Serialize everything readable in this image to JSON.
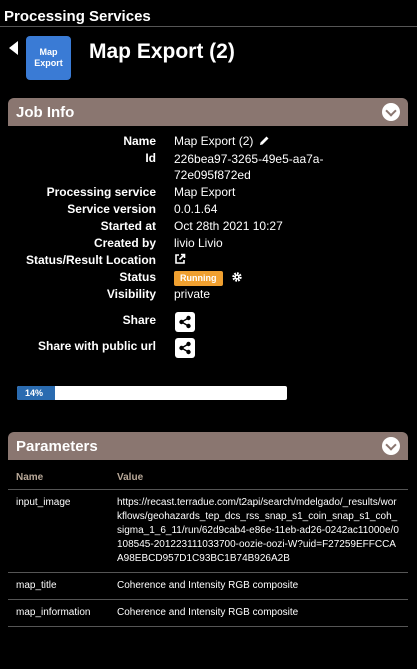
{
  "topbar": {
    "title": "Processing Services"
  },
  "header": {
    "icon_label": "Map Export",
    "title": "Map Export (2)"
  },
  "job_info": {
    "heading": "Job Info",
    "name_label": "Name",
    "name_value": "Map Export (2)",
    "id_label": "Id",
    "id_value": "226bea97-3265-49e5-aa7a-72e095f872ed",
    "service_label": "Processing service",
    "service_value": "Map Export",
    "version_label": "Service version",
    "version_value": "0.0.1.64",
    "started_label": "Started at",
    "started_value": "Oct 28th 2021 10:27",
    "created_label": "Created by",
    "created_value": "livio Livio",
    "location_label": "Status/Result Location",
    "status_label": "Status",
    "status_value": "Running",
    "visibility_label": "Visibility",
    "visibility_value": "private",
    "share_label": "Share",
    "share_public_label": "Share with public url"
  },
  "progress": {
    "label": "14%",
    "value": 0.14
  },
  "parameters": {
    "heading": "Parameters",
    "col_name": "Name",
    "col_value": "Value",
    "rows": [
      {
        "name": "input_image",
        "value": "https://recast.terradue.com/t2api/search/mdelgado/_results/workflows/geohazards_tep_dcs_rss_snap_s1_coin_snap_s1_coh_sigma_1_6_11/run/62d9cab4-e86e-11eb-ad26-0242ac11000e/0108545-201223111033700-oozie-oozi-W?uid=F27259EFFCCAA98EBCD957D1C93BC1B74B926A2B"
      },
      {
        "name": "map_title",
        "value": "Coherence and Intensity RGB composite"
      },
      {
        "name": "map_information",
        "value": "Coherence and Intensity RGB composite"
      }
    ]
  },
  "colors": {
    "panel_header": "#8a7670",
    "running_badge": "#f0a030",
    "progress_fill": "#2a6bb0",
    "app_icon": "#3a7bd5"
  }
}
